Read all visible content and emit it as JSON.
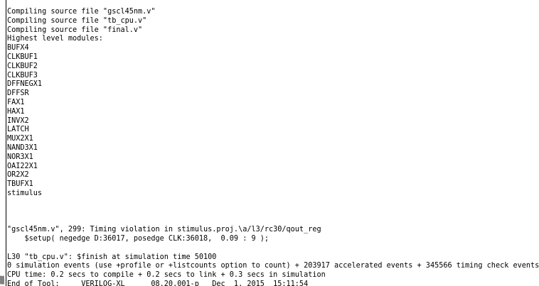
{
  "terminal": {
    "lines": [
      "Compiling source file \"gscl45nm.v\"",
      "Compiling source file \"tb_cpu.v\"",
      "Compiling source file \"final.v\"",
      "Highest level modules:",
      "BUFX4",
      "CLKBUF1",
      "CLKBUF2",
      "CLKBUF3",
      "DFFNEGX1",
      "DFFSR",
      "FAX1",
      "HAX1",
      "INVX2",
      "LATCH",
      "MUX2X1",
      "NAND3X1",
      "NOR3X1",
      "OAI22X1",
      "OR2X2",
      "TBUFX1",
      "stimulus",
      "",
      "",
      "",
      "\"gscl45nm.v\", 299: Timing violation in stimulus.proj.\\a/l3/rc30/qout_reg",
      "    $setup( negedge D:36017, posedge CLK:36018,  0.09 : 9 );",
      "",
      "L30 \"tb_cpu.v\": $finish at simulation time 50100",
      "0 simulation events (use +profile or +listcounts option to count) + 203917 accelerated events + 345566 timing check events",
      "CPU time: 0.2 secs to compile + 0.2 secs to link + 0.3 secs in simulation",
      "End of Tool:     VERILOG-XL      08.20.001-p   Dec  1, 2015  15:11:54"
    ],
    "cursor_glyph": "▒"
  }
}
